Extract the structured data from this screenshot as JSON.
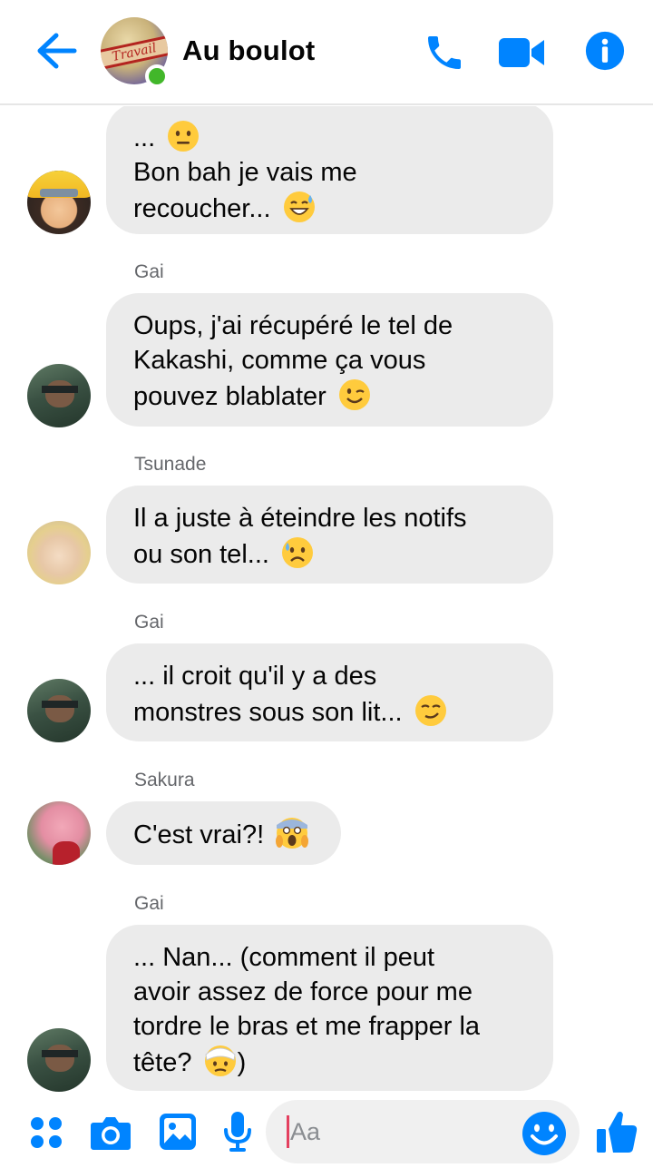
{
  "header": {
    "title": "Au boulot",
    "group_avatar_text": "Travail",
    "online": true,
    "accent_color": "#0084ff"
  },
  "messages": [
    {
      "sender": "",
      "avatar": "naruto",
      "lines": [
        "... ",
        "Bon bah je vais me",
        "recoucher... "
      ],
      "emoji_icons": [
        "neutral-face",
        "sweat-smile-face"
      ]
    },
    {
      "sender": "Gai",
      "avatar": "gai",
      "lines": [
        "Oups, j'ai récupéré le tel de",
        "Kakashi, comme ça vous",
        "pouvez blablater "
      ],
      "emoji_icons": [
        "wink-face"
      ]
    },
    {
      "sender": "Tsunade",
      "avatar": "tsunade",
      "lines": [
        "Il a juste à éteindre les notifs",
        "ou son tel... "
      ],
      "emoji_icons": [
        "frown-sweat-face"
      ]
    },
    {
      "sender": "Gai",
      "avatar": "gai",
      "lines": [
        "... il croit qu'il y a des",
        "monstres sous son lit... "
      ],
      "emoji_icons": [
        "smirk-face"
      ]
    },
    {
      "sender": "Sakura",
      "avatar": "sakura",
      "lines": [
        "C'est vrai?! "
      ],
      "emoji_icons": [
        "scream-face"
      ]
    },
    {
      "sender": "Gai",
      "avatar": "gai",
      "lines": [
        "... Nan... (comment il peut",
        "avoir assez de force pour me",
        "tordre le bras et me frapper la",
        "tête? ",
        ")"
      ],
      "emoji_icons": [
        "bandaged-face"
      ]
    }
  ],
  "composer": {
    "placeholder": "Aa",
    "icons": [
      "menu-dots-icon",
      "camera-icon",
      "gallery-icon",
      "microphone-icon",
      "emoji-icon",
      "thumbs-up-icon"
    ]
  }
}
